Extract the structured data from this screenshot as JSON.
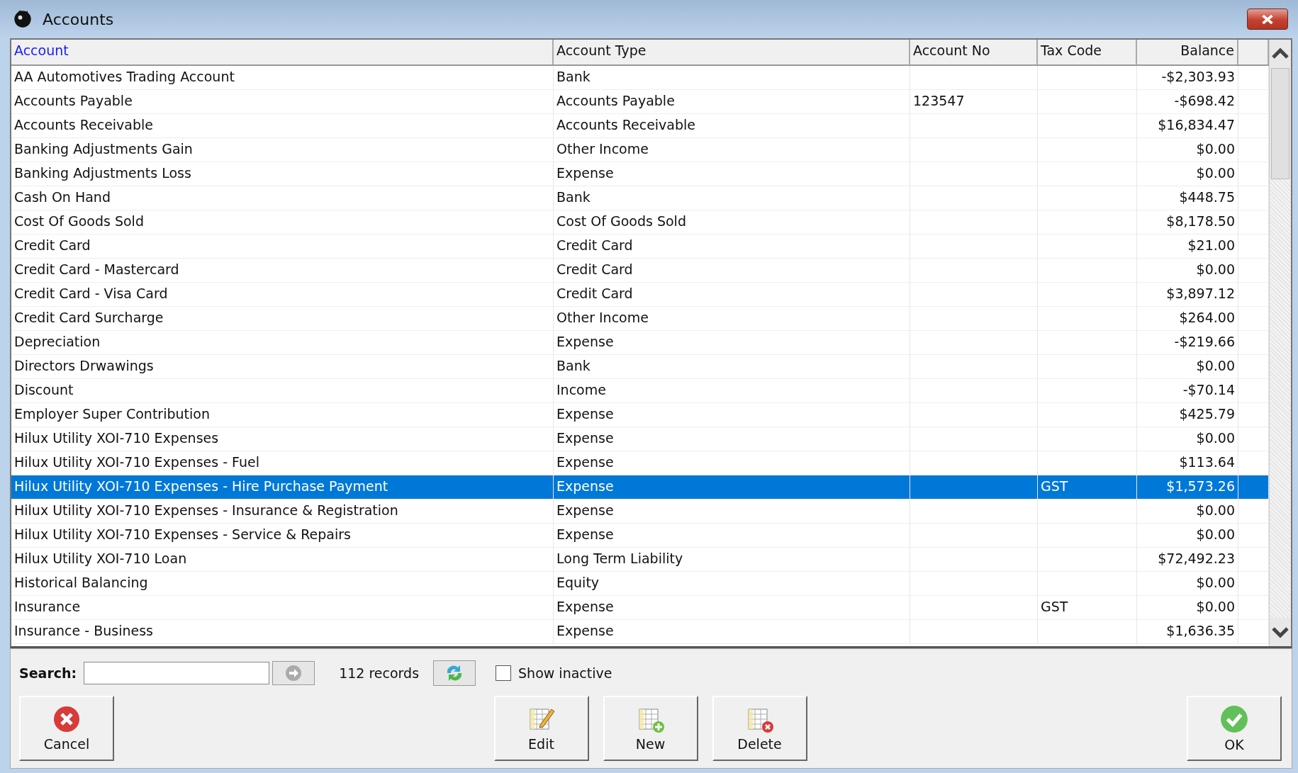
{
  "window": {
    "title": "Accounts"
  },
  "table": {
    "columns": [
      {
        "label": "Account",
        "sorted": true
      },
      {
        "label": "Account Type",
        "sorted": false
      },
      {
        "label": "Account No",
        "sorted": false
      },
      {
        "label": "Tax Code",
        "sorted": false
      },
      {
        "label": "Balance",
        "sorted": false
      }
    ],
    "rows": [
      {
        "cells": [
          "AA Automotives Trading Account",
          "Bank",
          "",
          "",
          "-$2,303.93"
        ],
        "selected": false
      },
      {
        "cells": [
          "Accounts Payable",
          "Accounts Payable",
          "123547",
          "",
          "-$698.42"
        ],
        "selected": false
      },
      {
        "cells": [
          "Accounts Receivable",
          "Accounts Receivable",
          "",
          "",
          "$16,834.47"
        ],
        "selected": false
      },
      {
        "cells": [
          "Banking Adjustments Gain",
          "Other Income",
          "",
          "",
          "$0.00"
        ],
        "selected": false
      },
      {
        "cells": [
          "Banking Adjustments Loss",
          "Expense",
          "",
          "",
          "$0.00"
        ],
        "selected": false
      },
      {
        "cells": [
          "Cash On Hand",
          "Bank",
          "",
          "",
          "$448.75"
        ],
        "selected": false
      },
      {
        "cells": [
          "Cost Of Goods Sold",
          "Cost Of Goods Sold",
          "",
          "",
          "$8,178.50"
        ],
        "selected": false
      },
      {
        "cells": [
          "Credit Card",
          "Credit Card",
          "",
          "",
          "$21.00"
        ],
        "selected": false
      },
      {
        "cells": [
          "Credit Card - Mastercard",
          "Credit Card",
          "",
          "",
          "$0.00"
        ],
        "selected": false
      },
      {
        "cells": [
          "Credit Card - Visa Card",
          "Credit Card",
          "",
          "",
          "$3,897.12"
        ],
        "selected": false
      },
      {
        "cells": [
          "Credit Card Surcharge",
          "Other Income",
          "",
          "",
          "$264.00"
        ],
        "selected": false
      },
      {
        "cells": [
          "Depreciation",
          "Expense",
          "",
          "",
          "-$219.66"
        ],
        "selected": false
      },
      {
        "cells": [
          "Directors Drwawings",
          "Bank",
          "",
          "",
          "$0.00"
        ],
        "selected": false
      },
      {
        "cells": [
          "Discount",
          "Income",
          "",
          "",
          "-$70.14"
        ],
        "selected": false
      },
      {
        "cells": [
          "Employer Super Contribution",
          "Expense",
          "",
          "",
          "$425.79"
        ],
        "selected": false
      },
      {
        "cells": [
          "Hilux Utility XOI-710 Expenses",
          "Expense",
          "",
          "",
          "$0.00"
        ],
        "selected": false
      },
      {
        "cells": [
          "Hilux Utility XOI-710 Expenses - Fuel",
          "Expense",
          "",
          "",
          "$113.64"
        ],
        "selected": false
      },
      {
        "cells": [
          "Hilux Utility XOI-710 Expenses - Hire Purchase Payment",
          "Expense",
          "",
          "GST",
          "$1,573.26"
        ],
        "selected": true
      },
      {
        "cells": [
          "Hilux Utility XOI-710 Expenses - Insurance & Registration",
          "Expense",
          "",
          "",
          "$0.00"
        ],
        "selected": false
      },
      {
        "cells": [
          "Hilux Utility XOI-710 Expenses - Service & Repairs",
          "Expense",
          "",
          "",
          "$0.00"
        ],
        "selected": false
      },
      {
        "cells": [
          "Hilux Utility XOI-710 Loan",
          "Long Term Liability",
          "",
          "",
          "$72,492.23"
        ],
        "selected": false
      },
      {
        "cells": [
          "Historical Balancing",
          "Equity",
          "",
          "",
          "$0.00"
        ],
        "selected": false
      },
      {
        "cells": [
          "Insurance",
          "Expense",
          "",
          "GST",
          "$0.00"
        ],
        "selected": false
      },
      {
        "cells": [
          "Insurance - Business",
          "Expense",
          "",
          "",
          "$1,636.35"
        ],
        "selected": false
      }
    ]
  },
  "search": {
    "label": "Search:",
    "records": "112 records"
  },
  "show_inactive": {
    "label": "Show inactive",
    "checked": false
  },
  "buttons": [
    {
      "kind": "cancel",
      "label": "Cancel"
    },
    {
      "kind": "edit",
      "label": "Edit"
    },
    {
      "kind": "new",
      "label": "New"
    },
    {
      "kind": "delete",
      "label": "Delete"
    },
    {
      "kind": "ok",
      "label": "OK"
    }
  ]
}
